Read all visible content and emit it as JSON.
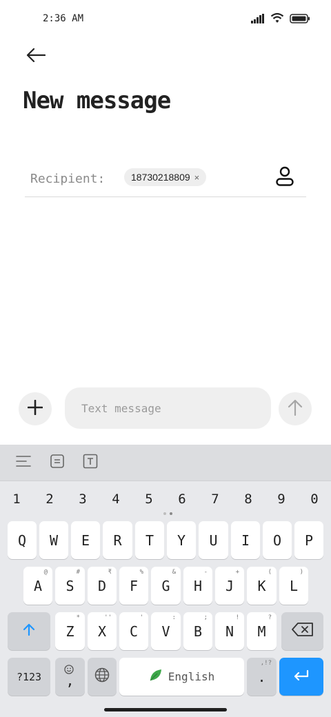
{
  "status_bar": {
    "time": "2:36 AM"
  },
  "header": {
    "title": "New message"
  },
  "recipient": {
    "label": "Recipient:",
    "chip_number": "18730218809",
    "chip_remove": "×"
  },
  "compose": {
    "placeholder": "Text message"
  },
  "keyboard": {
    "number_row": [
      "1",
      "2",
      "3",
      "4",
      "5",
      "6",
      "7",
      "8",
      "9",
      "0"
    ],
    "row1": [
      {
        "key": "Q",
        "hint": ""
      },
      {
        "key": "W",
        "hint": ""
      },
      {
        "key": "E",
        "hint": ""
      },
      {
        "key": "R",
        "hint": ""
      },
      {
        "key": "T",
        "hint": ""
      },
      {
        "key": "Y",
        "hint": ""
      },
      {
        "key": "U",
        "hint": ""
      },
      {
        "key": "I",
        "hint": ""
      },
      {
        "key": "O",
        "hint": ""
      },
      {
        "key": "P",
        "hint": ""
      }
    ],
    "row2": [
      {
        "key": "A",
        "hint": "@"
      },
      {
        "key": "S",
        "hint": "#"
      },
      {
        "key": "D",
        "hint": "₹"
      },
      {
        "key": "F",
        "hint": "%"
      },
      {
        "key": "G",
        "hint": "&"
      },
      {
        "key": "H",
        "hint": "-"
      },
      {
        "key": "J",
        "hint": "+"
      },
      {
        "key": "K",
        "hint": "("
      },
      {
        "key": "L",
        "hint": ")"
      }
    ],
    "row3": [
      {
        "key": "Z",
        "hint": "*"
      },
      {
        "key": "X",
        "hint": "''"
      },
      {
        "key": "C",
        "hint": "'"
      },
      {
        "key": "V",
        "hint": ":"
      },
      {
        "key": "B",
        "hint": ";"
      },
      {
        "key": "N",
        "hint": "!"
      },
      {
        "key": "M",
        "hint": "?"
      }
    ],
    "symbols_label": "?123",
    "comma_label": ",",
    "space_label": "English",
    "period_label": ".",
    "period_hint": ",!?",
    "accent_color": "#1e96ff"
  }
}
